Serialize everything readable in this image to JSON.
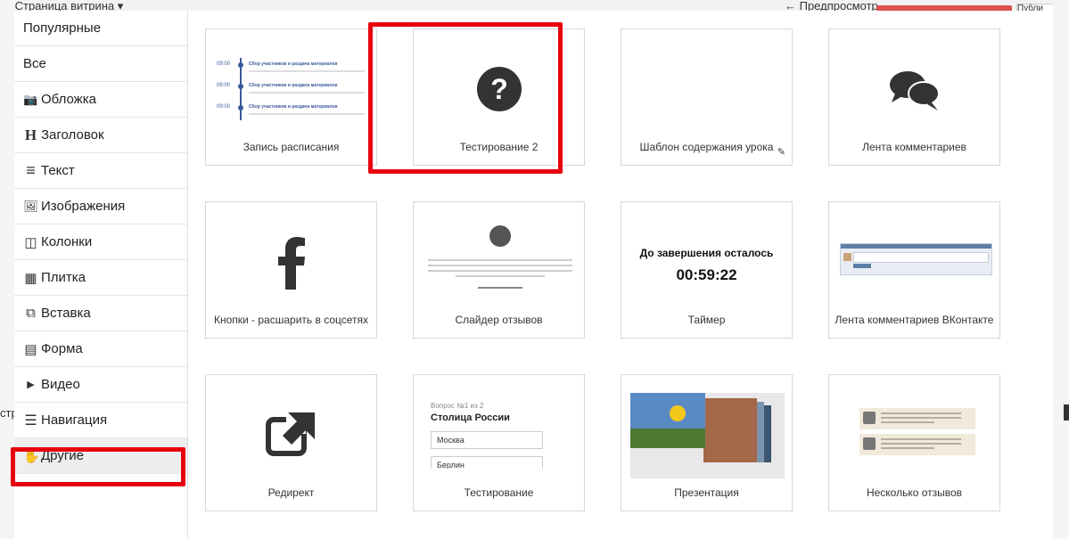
{
  "background": {
    "title_fragment": "→ Страница витрина ▾",
    "right_fragment": "← Предпросмотр",
    "right_button_fragment": "Публи",
    "left_edge_fragment": "стр"
  },
  "sidebar": {
    "items": [
      {
        "label": "Популярные",
        "icon": ""
      },
      {
        "label": "Все",
        "icon": ""
      },
      {
        "label": "Обложка",
        "icon": "📷"
      },
      {
        "label": "Заголовок",
        "icon": "H"
      },
      {
        "label": "Текст",
        "icon": "≡"
      },
      {
        "label": "Изображения",
        "icon": "🖼"
      },
      {
        "label": "Колонки",
        "icon": "◫"
      },
      {
        "label": "Плитка",
        "icon": "▦"
      },
      {
        "label": "Вставка",
        "icon": "⧉"
      },
      {
        "label": "Форма",
        "icon": "▤"
      },
      {
        "label": "Видео",
        "icon": "▶"
      },
      {
        "label": "Навигация",
        "icon": "☰"
      },
      {
        "label": "Другие",
        "icon": "✋"
      }
    ],
    "active_index": 12
  },
  "tiles": [
    {
      "label": "Запись расписания"
    },
    {
      "label": "Тестирование 2"
    },
    {
      "label": "Шаблон содержания урока"
    },
    {
      "label": "Лента комментариев"
    },
    {
      "label": "Кнопки - расшарить в соцсетях"
    },
    {
      "label": "Слайдер отзывов"
    },
    {
      "label": "Таймер"
    },
    {
      "label": "Лента комментариев ВКонтакте"
    },
    {
      "label": "Редирект"
    },
    {
      "label": "Тестирование"
    },
    {
      "label": "Презентация"
    },
    {
      "label": "Несколько отзывов"
    }
  ],
  "schedule_preview": {
    "time": "09:00",
    "title": "Сбор участников и раздача материалов"
  },
  "timer_preview": {
    "title": "До завершения осталось",
    "value": "00:59:22"
  },
  "quiz_preview": {
    "question_no": "Вопрос №1 из 2",
    "question": "Столица России",
    "options": [
      "Москва",
      "Берлин"
    ]
  },
  "colors": {
    "highlight": "#e8000f",
    "icon_dark": "#333333",
    "accent_blue": "#3a5a9a"
  }
}
